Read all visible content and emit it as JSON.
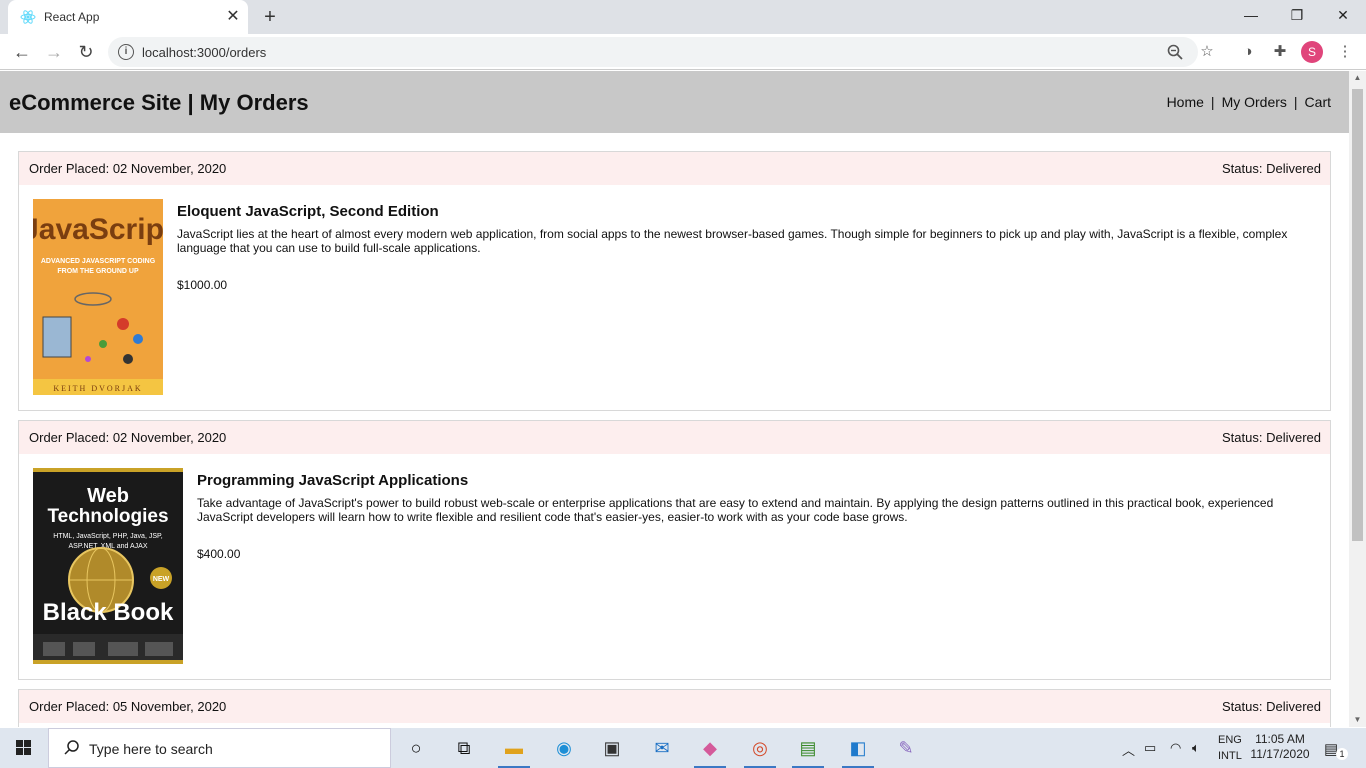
{
  "browser": {
    "tab_title": "React App",
    "tab_close": "✕",
    "new_tab": "+",
    "url": "localhost:3000/orders",
    "profile_initial": "S",
    "window_controls": {
      "minimize": "—",
      "maximize": "❐",
      "close": "✕"
    }
  },
  "site": {
    "title": "eCommerce Site | My Orders",
    "nav": [
      {
        "label": "Home"
      },
      {
        "label": "My Orders"
      },
      {
        "label": "Cart"
      }
    ],
    "nav_separator": "|"
  },
  "orders": [
    {
      "placed": "Order Placed: 02 November, 2020",
      "status": "Status: Delivered",
      "product": {
        "title": "Eloquent JavaScript, Second Edition",
        "description": "JavaScript lies at the heart of almost every modern web application, from social apps to the newest browser-based games. Though simple for beginners to pick up and play with, JavaScript is a flexible, complex language that you can use to build full-scale applications.",
        "price": "$1000.00",
        "cover": {
          "title": "JavaScript",
          "subtitle": "ADVANCED JAVASCRIPT CODING FROM THE GROUND UP",
          "author": "KEITH DVORJAK",
          "color": "#f0a33c"
        }
      }
    },
    {
      "placed": "Order Placed: 02 November, 2020",
      "status": "Status: Delivered",
      "product": {
        "title": "Programming JavaScript Applications",
        "description": "Take advantage of JavaScript's power to build robust web-scale or enterprise applications that are easy to extend and maintain. By applying the design patterns outlined in this practical book, experienced JavaScript developers will learn how to write flexible and resilient code that's easier-yes, easier-to work with as your code base grows.",
        "price": "$400.00",
        "cover": {
          "title_line1": "Web",
          "title_line2": "Technologies",
          "subtitle": "HTML, JavaScript, PHP, Java, JSP, ASP.NET, XML and AJAX",
          "bottom": "Black Book",
          "badge": "NEW",
          "color": "#1a1a1a"
        }
      }
    },
    {
      "placed": "Order Placed: 05 November, 2020",
      "status": "Status: Delivered"
    }
  ],
  "taskbar": {
    "search_placeholder": "Type here to search",
    "lang_line1": "ENG",
    "lang_line2": "INTL",
    "time": "11:05 AM",
    "date": "11/17/2020",
    "notification_count": "1"
  },
  "colors": {
    "header_bg": "#c8c8c8",
    "order_head_bg": "#fdeeee",
    "taskbar_bg": "#dfe6ef"
  }
}
